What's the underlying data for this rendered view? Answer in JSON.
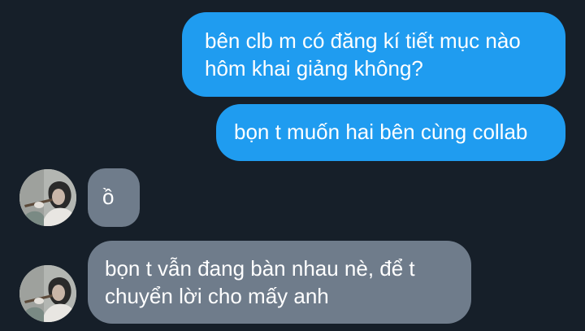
{
  "conversation": {
    "messages": [
      {
        "direction": "outgoing",
        "lines": [
          "bên clb m có đăng kí tiết mục nào",
          "hôm khai giảng không?"
        ]
      },
      {
        "direction": "outgoing",
        "lines": [
          "bọn t muốn hai bên cùng collab"
        ]
      },
      {
        "direction": "incoming",
        "lines": [
          "ồ"
        ]
      },
      {
        "direction": "incoming",
        "lines": [
          "bọn t vẫn đang bàn nhau nè, để t",
          "chuyển lời cho mấy anh"
        ]
      }
    ]
  },
  "colors": {
    "background": "#161f29",
    "outgoing_bubble": "#1f9cf0",
    "incoming_bubble": "#6f7c8b",
    "text": "#ffffff"
  }
}
